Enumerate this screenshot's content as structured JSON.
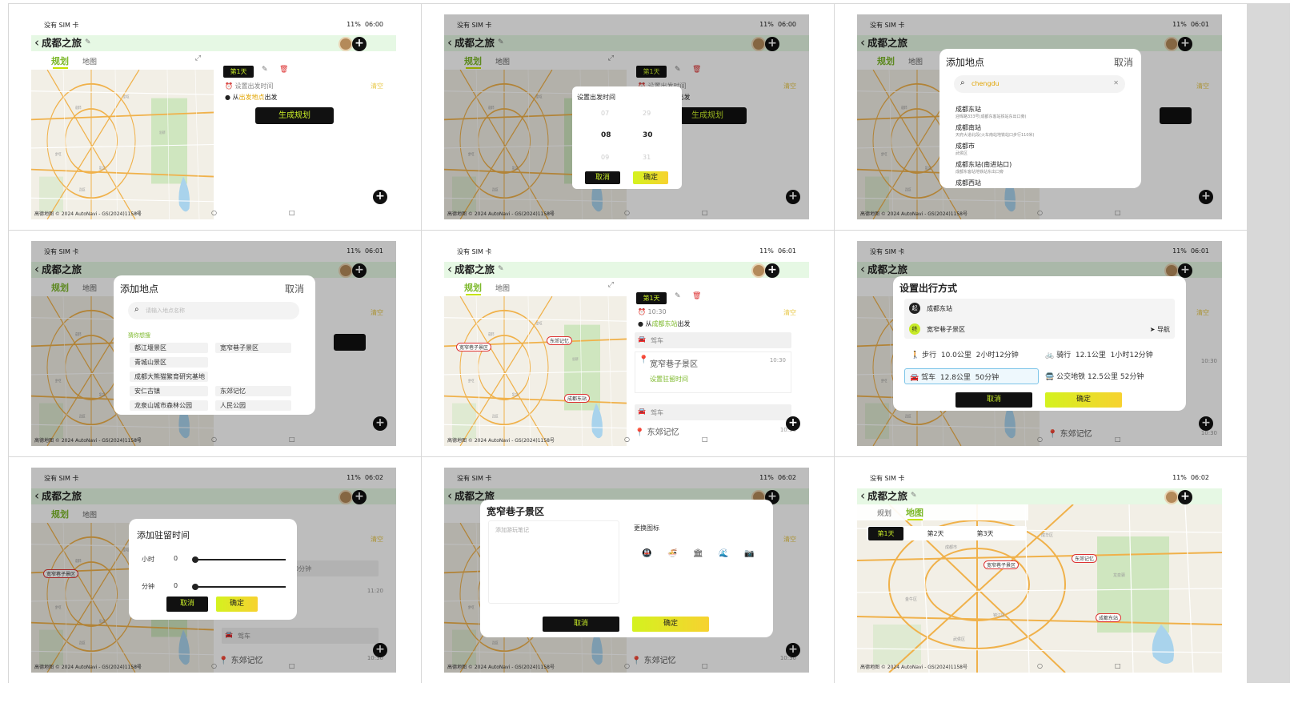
{
  "status": {
    "carrier": "没有 SIM 卡",
    "battery": "11%",
    "times": [
      "06:00",
      "06:00",
      "06:01",
      "06:01",
      "06:01",
      "06:01",
      "06:02",
      "06:02",
      "06:02"
    ]
  },
  "header": {
    "back": "<",
    "title": "成都之旅",
    "edit_icon": "pencil-icon",
    "add_icon": "plus-icon"
  },
  "tabs": {
    "plan": "规划",
    "map": "地图"
  },
  "map_credit": "高德地图 © 2024 AutoNavi - GS(2024)1158号",
  "plan_panel": {
    "day1": "第1天",
    "set_time": "设置出发时间",
    "from_prefix": "从",
    "from_place": "出发地点",
    "from_suffix": "出发",
    "clear": "清空",
    "generate": "生成规划"
  },
  "time_picker": {
    "title": "设置出发时间",
    "hours": [
      "07",
      "08",
      "09"
    ],
    "minutes": [
      "29",
      "30",
      "31"
    ],
    "cancel": "取消",
    "confirm": "确定"
  },
  "add_place": {
    "title": "添加地点",
    "cancel": "取消",
    "query": "chengdu",
    "placeholder": "请输入地点名称",
    "results": [
      {
        "name": "成都东站",
        "addr": "迎晖路333号(成都东客站铁站东出口旁)"
      },
      {
        "name": "成都南站",
        "addr": "天府大道北段(火车南站地铁站口步行110米)"
      },
      {
        "name": "成都市",
        "addr": "武侯区"
      },
      {
        "name": "成都东站(南进站口)",
        "addr": "成都东客站地铁站东出口旁"
      },
      {
        "name": "成都西站",
        "addr": ""
      }
    ],
    "guess_title": "猜你想搜",
    "guess": [
      "都江堰景区",
      "宽窄巷子景区",
      "青城山景区",
      "成都大熊猫繁育研究基地",
      "安仁古镇",
      "东郊记忆",
      "龙泉山城市森林公园",
      "人民公园"
    ]
  },
  "itinerary": {
    "time": "10:30",
    "from_prefix": "从",
    "from_place": "成都东站",
    "from_suffix": "出发",
    "drive": "驾车",
    "poi1": "宽窄巷子景区",
    "poi1_time": "10:30",
    "set_stay": "设置驻留时间",
    "poi2": "东郊记忆",
    "poi2_time": "10:30",
    "stay_label": "50分钟",
    "poi1_time_b": "11:20",
    "poi2_time_b": "10:30"
  },
  "map_markers": [
    "宽窄巷子景区",
    "东郊记忆",
    "成都东站"
  ],
  "travel": {
    "title": "设置出行方式",
    "start_badge": "起",
    "start": "成都东站",
    "end_badge": "终",
    "end": "宽窄巷子景区",
    "nav": "导航",
    "walk": {
      "label": "步行",
      "dist": "10.0公里",
      "time": "2小时12分钟"
    },
    "bike": {
      "label": "骑行",
      "dist": "12.1公里",
      "time": "1小时12分钟"
    },
    "car": {
      "label": "驾车",
      "dist": "12.8公里",
      "time": "50分钟"
    },
    "transit": {
      "label": "公交地铁",
      "dist": "12.5公里",
      "time": "52分钟"
    },
    "cancel": "取消",
    "confirm": "确定"
  },
  "stay": {
    "title": "添加驻留时间",
    "hour_label": "小时",
    "hour": "0",
    "min_label": "分钟",
    "min": "0",
    "cancel": "取消",
    "confirm": "确定"
  },
  "note": {
    "title": "宽窄巷子景区",
    "placeholder": "添加游玩笔记",
    "icon_title": "更换图标",
    "icons": [
      "metro-icon",
      "food-icon",
      "building-icon",
      "wave-icon",
      "camera-icon"
    ],
    "cancel": "取消",
    "confirm": "确定"
  },
  "days": [
    "第1天",
    "第2天",
    "第3天"
  ],
  "colors": {
    "accent": "#c7ea28",
    "header_bg": "#e6f8e4",
    "brand_green": "#7cb82a",
    "orange": "#e1a400"
  }
}
